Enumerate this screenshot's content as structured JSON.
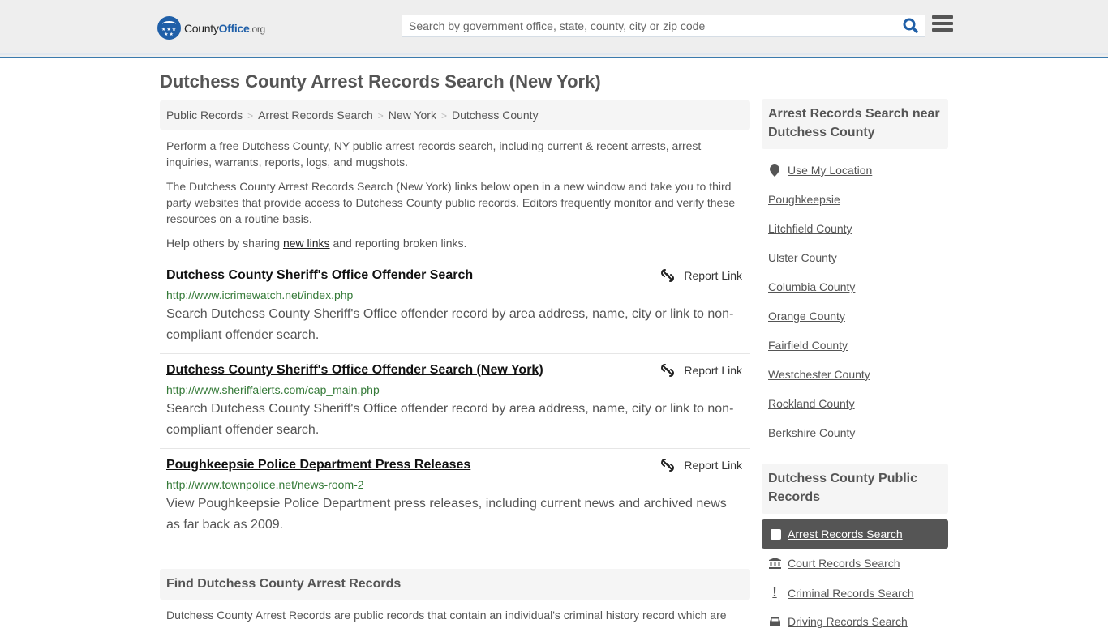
{
  "header": {
    "logo": {
      "county": "County",
      "office": "Office",
      "org": ".org"
    },
    "search_placeholder": "Search by government office, state, county, city or zip code",
    "search_value": ""
  },
  "page_title": "Dutchess County Arrest Records Search (New York)",
  "breadcrumb": [
    "Public Records",
    "Arrest Records Search",
    "New York",
    "Dutchess County"
  ],
  "intro": {
    "p1": "Perform a free Dutchess County, NY public arrest records search, including current & recent arrests, arrest inquiries, warrants, reports, logs, and mugshots.",
    "p2": "The Dutchess County Arrest Records Search (New York) links below open in a new window and take you to third party websites that provide access to Dutchess County public records. Editors frequently monitor and verify these resources on a routine basis.",
    "p3_before": "Help others by sharing ",
    "p3_link": "new links",
    "p3_after": " and reporting broken links."
  },
  "results": [
    {
      "title": "Dutchess County Sheriff's Office Offender Search",
      "url": "http://www.icrimewatch.net/index.php",
      "description": "Search Dutchess County Sheriff's Office offender record by area address, name, city or link to non-compliant offender search.",
      "report_label": "Report Link"
    },
    {
      "title": "Dutchess County Sheriff's Office Offender Search (New York)",
      "url": "http://www.sheriffalerts.com/cap_main.php",
      "description": "Search Dutchess County Sheriff's Office offender record by area address, name, city or link to non-compliant offender search.",
      "report_label": "Report Link"
    },
    {
      "title": "Poughkeepsie Police Department Press Releases",
      "url": "http://www.townpolice.net/news-room-2",
      "description": "View Poughkeepsie Police Department press releases, including current news and archived news as far back as 2009.",
      "report_label": "Report Link"
    }
  ],
  "find_section": {
    "title": "Find Dutchess County Arrest Records",
    "body": "Dutchess County Arrest Records are public records that contain an individual's criminal history record which are"
  },
  "sidebar": {
    "nearby_title": "Arrest Records Search near Dutchess County",
    "use_location": "Use My Location",
    "nearby": [
      "Poughkeepsie",
      "Litchfield County",
      "Ulster County",
      "Columbia County",
      "Orange County",
      "Fairfield County",
      "Westchester County",
      "Rockland County",
      "Berkshire County"
    ],
    "records_title": "Dutchess County Public Records",
    "records": [
      {
        "label": "Arrest Records Search",
        "icon": "square-icon",
        "active": true
      },
      {
        "label": "Court Records Search",
        "icon": "courthouse-icon",
        "active": false
      },
      {
        "label": "Criminal Records Search",
        "icon": "exclamation-icon",
        "active": false
      },
      {
        "label": "Driving Records Search",
        "icon": "car-icon",
        "active": false
      }
    ]
  },
  "colors": {
    "brand_blue": "#1f5fa8",
    "header_border": "#3a7aad",
    "url_green": "#357a38",
    "active_bg": "#555555"
  }
}
